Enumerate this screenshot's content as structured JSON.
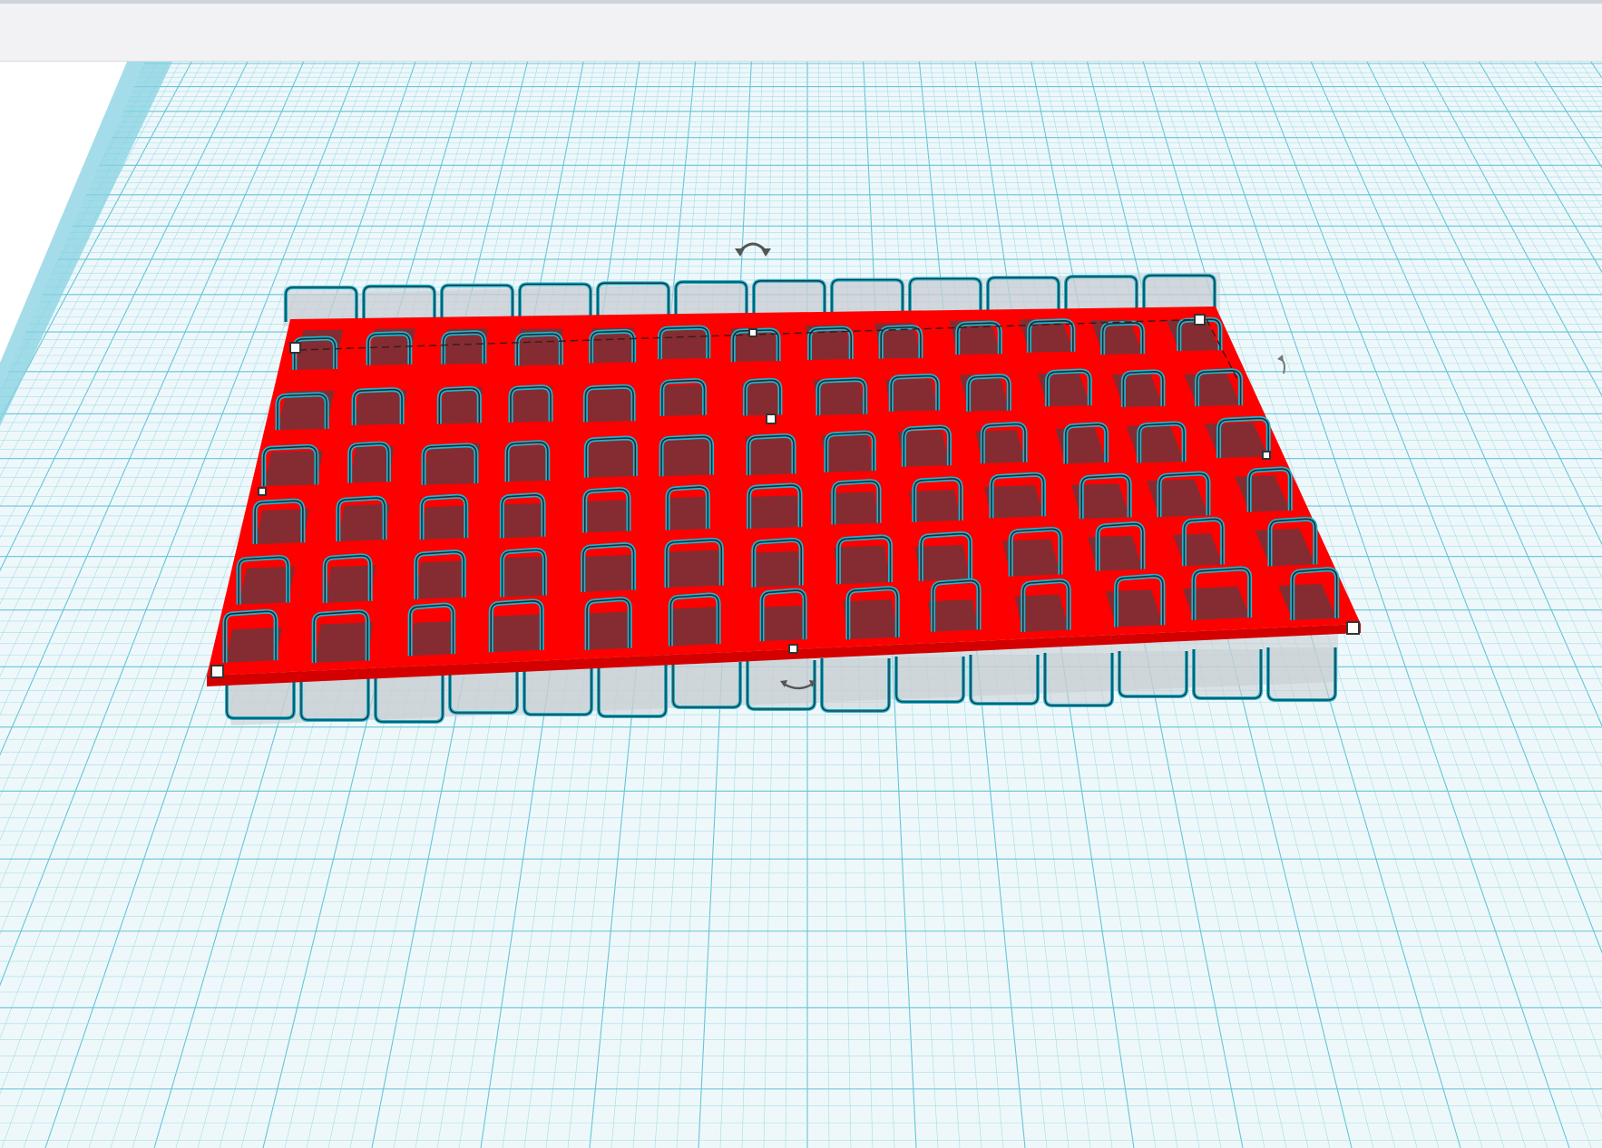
{
  "app": {
    "toolbar": {
      "items": []
    },
    "workplane": {
      "grid_color": "#a7dbe6",
      "grid_major_color": "#66c4d6",
      "edge_color": "#4fbfd6"
    },
    "selection": {
      "base_fill": "#ff0000",
      "cell_fill": "#7a3036",
      "outline_color": "#1fb4cf",
      "ghost_fill": "#c9ced3",
      "handle_fill": "#ffffff",
      "handle_stroke": "#333333"
    },
    "controls": {
      "rotate_top_icon": "rotate-arrow-icon",
      "rotate_front_icon": "rotate-arrow-icon",
      "rotate_side_icon": "rotate-arrow-icon"
    }
  }
}
